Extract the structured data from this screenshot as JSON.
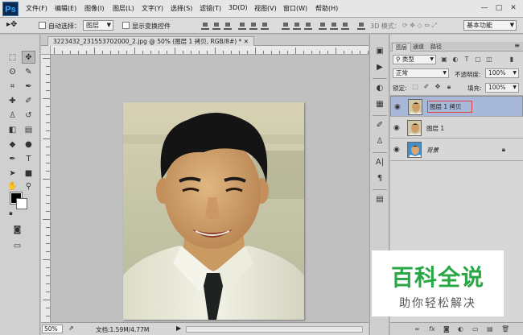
{
  "app": {
    "logo": "Ps"
  },
  "menu": [
    "文件(F)",
    "编辑(E)",
    "图像(I)",
    "图层(L)",
    "文字(Y)",
    "选择(S)",
    "滤镜(T)",
    "3D(D)",
    "视图(V)",
    "窗口(W)",
    "帮助(H)"
  ],
  "window_controls": {
    "minimize": "—",
    "maximize": "□",
    "close": "✕"
  },
  "options": {
    "auto_select_label": "自动选择：",
    "auto_select_value": "图层",
    "show_transform_label": "显示变换控件",
    "mode_3d_label": "3D 模式：",
    "workspace": "基本功能"
  },
  "document": {
    "tab_title": "3223432_231553702000_2.jpg @ 50% (图层 1 拷贝, RGB/8#) *",
    "zoom": "50%",
    "doc_info": "文档:1.59M/4.77M"
  },
  "layers_panel": {
    "tabs": [
      "图层",
      "通道",
      "路径"
    ],
    "filter_kind": "类型",
    "blend_mode": "正常",
    "opacity_label": "不透明度:",
    "opacity_value": "100%",
    "lock_label": "锁定:",
    "fill_label": "填充:",
    "fill_value": "100%",
    "layers": [
      {
        "name": "图层 1 拷贝",
        "selected": true
      },
      {
        "name": "图层 1",
        "selected": false
      },
      {
        "name": "背景",
        "selected": false,
        "locked": true
      }
    ],
    "footer_icons": [
      "link-icon",
      "fx-icon",
      "mask-icon",
      "adjustment-icon",
      "group-icon",
      "new-layer-icon",
      "trash-icon"
    ]
  },
  "watermark": {
    "title": "百科全说",
    "subtitle": "助你轻松解决"
  },
  "colors": {
    "selected_layer": "#a8b8d8",
    "watermark_green": "#28a745"
  }
}
